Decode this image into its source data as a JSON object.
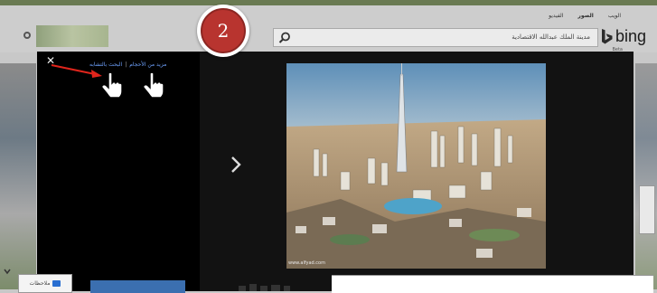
{
  "header": {
    "nav_links": [
      "الويب",
      "الصور",
      "الفيديو"
    ],
    "active_nav": "الصور",
    "brand": "bing",
    "brand_sub": "Beta"
  },
  "search": {
    "query": "مدينة الملك عبدالله الاقتصادية"
  },
  "overlay": {
    "close_label": "✕",
    "link_collection": "مزيد من الأحجام",
    "link_separator": "|",
    "link_related": "البحث بالتشابه",
    "watermark": "www.alfyad.com"
  },
  "step": {
    "number": "2"
  },
  "feedback": {
    "label": "ملاحظات"
  },
  "colors": {
    "badge_red": "#b8342f",
    "link_blue": "#6fa3ff",
    "arrow_red": "#e0251c"
  }
}
